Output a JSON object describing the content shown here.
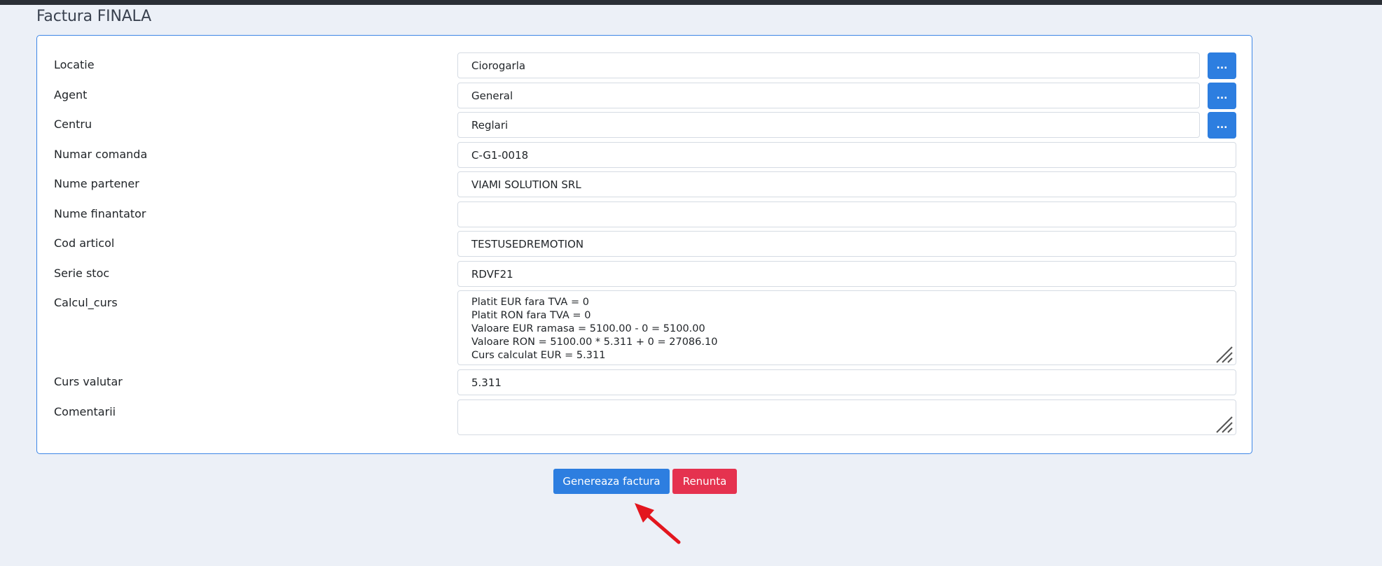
{
  "page": {
    "title": "Factura FINALA"
  },
  "form": {
    "locatie": {
      "label": "Locatie",
      "value": "Ciorogarla",
      "button": "..."
    },
    "agent": {
      "label": "Agent",
      "value": "General",
      "button": "..."
    },
    "centru": {
      "label": "Centru",
      "value": "Reglari",
      "button": "..."
    },
    "numar_comanda": {
      "label": "Numar comanda",
      "value": "C-G1-0018"
    },
    "nume_partener": {
      "label": "Nume partener",
      "value": "VIAMI SOLUTION SRL"
    },
    "nume_finantator": {
      "label": "Nume finantator",
      "value": ""
    },
    "cod_articol": {
      "label": "Cod articol",
      "value": "TESTUSEDREMOTION"
    },
    "serie_stoc": {
      "label": "Serie stoc",
      "value": "RDVF21"
    },
    "calcul_curs": {
      "label": "Calcul_curs",
      "value": "Platit EUR fara TVA = 0\nPlatit RON fara TVA = 0\nValoare EUR ramasa = 5100.00 - 0 = 5100.00\nValoare RON = 5100.00 * 5.311 + 0 = 27086.10\nCurs calculat EUR = 5.311"
    },
    "curs_valutar": {
      "label": "Curs valutar",
      "value": "5.311"
    },
    "comentarii": {
      "label": "Comentarii",
      "value": ""
    }
  },
  "actions": {
    "generate_label": "Genereaza factura",
    "cancel_label": "Renunta",
    "primary_color": "#2d7ee0",
    "danger_color": "#e5324f"
  },
  "annotation": {
    "arrow_color": "#e3161e",
    "arrow_icon": "red-arrow-icon"
  }
}
